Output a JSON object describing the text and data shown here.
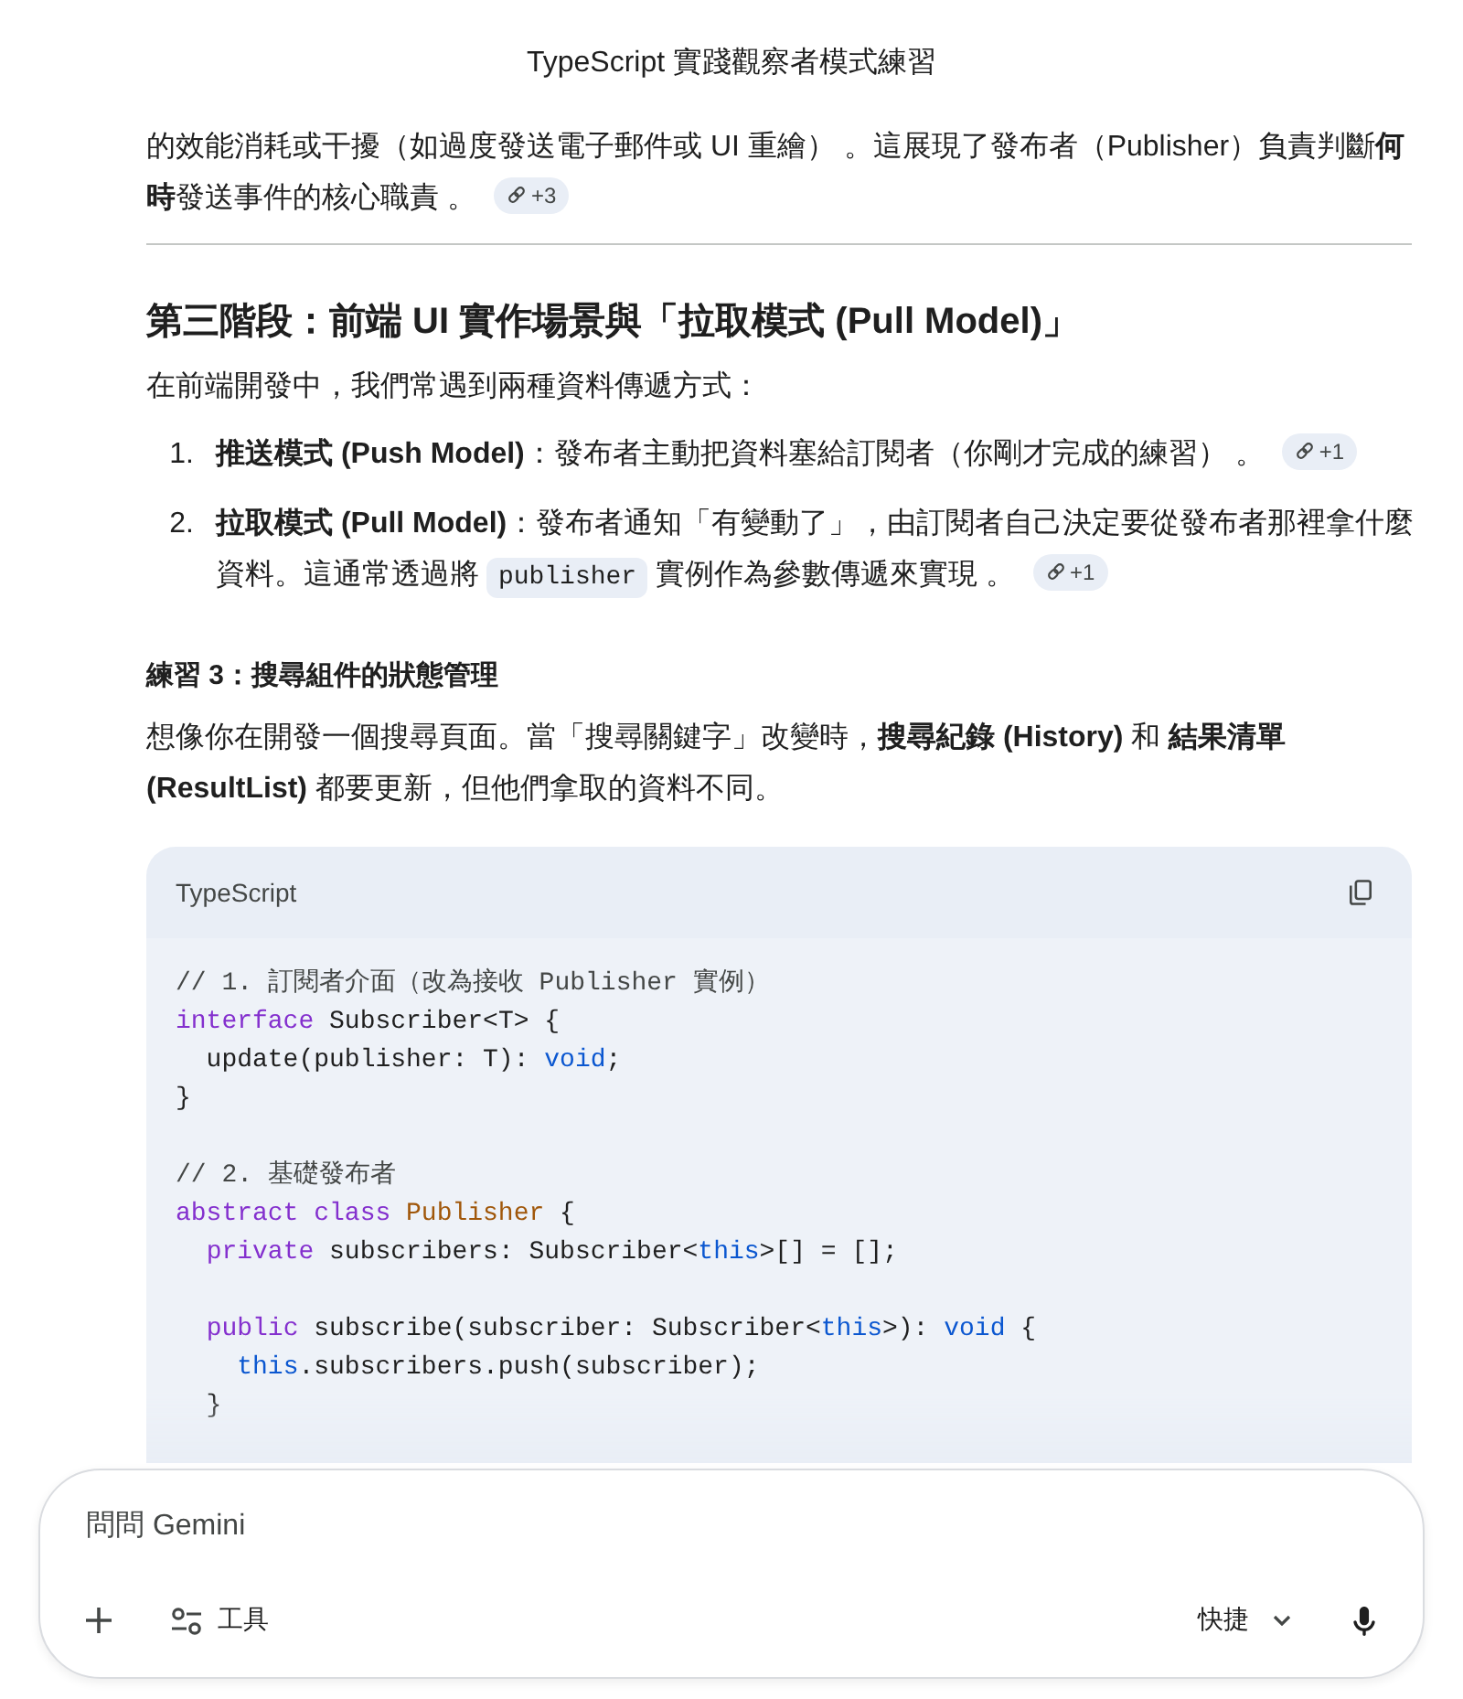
{
  "header": {
    "title": "TypeScript 實踐觀察者模式練習"
  },
  "article": {
    "blocks": [
      {
        "kind": "paragraph",
        "text": "的效能消耗或干擾（如過度發送電子郵件或 UI 重繪） 。這展現了發布者（Publisher）負責判斷**何時**發送事件的核心職責 。",
        "chip": "+3"
      },
      {
        "kind": "divider"
      },
      {
        "kind": "heading",
        "text": "第三階段：前端 UI 實作場景與「拉取模式 (Pull Model)」"
      },
      {
        "kind": "paragraph",
        "text": "在前端開發中，我們常遇到兩種資料傳遞方式："
      },
      {
        "kind": "ordered_list",
        "items": [
          {
            "number": "1.",
            "segments": [
              {
                "kind": "text",
                "text": "**推送模式 (Push Model)**：發布者主動把資料塞給訂閱者（你剛才完成的練習） 。"
              }
            ],
            "chip": "+1"
          },
          {
            "number": "2.",
            "segments": [
              {
                "kind": "text",
                "text": "**拉取模式 (Pull Model)**：發布者通知「有變動了」，由訂閱者自己決定要從發布者那裡拿什麼資料。這通常透過將 "
              },
              {
                "kind": "code",
                "text": "publisher"
              },
              {
                "kind": "text",
                "text": " 實例作為參數傳遞來實現 。"
              }
            ],
            "chip": "+1"
          }
        ]
      },
      {
        "kind": "subheading",
        "text": "練習 3：搜尋組件的狀態管理"
      },
      {
        "kind": "paragraph",
        "text": "想像你在開發一個搜尋頁面。當「搜尋關鍵字」改變時，**搜尋紀錄 (History)** 和 **結果清單 (ResultList)** 都要更新，但他們拿取的資料不同。"
      },
      {
        "kind": "code_block",
        "language": "TypeScript",
        "tokens": [
          {
            "kind": "comment",
            "text": "// 1. 訂閱者介面（改為接收 Publisher 實例）\n"
          },
          {
            "kind": "keyword",
            "text": "interface"
          },
          {
            "kind": "plain",
            "text": " Subscriber<T> {\n  update(publisher: T): "
          },
          {
            "kind": "builtin",
            "text": "void"
          },
          {
            "kind": "plain",
            "text": ";\n}\n\n"
          },
          {
            "kind": "comment",
            "text": "// 2. 基礎發布者\n"
          },
          {
            "kind": "keyword",
            "text": "abstract class"
          },
          {
            "kind": "type",
            "text": " Publisher"
          },
          {
            "kind": "plain",
            "text": " {\n  "
          },
          {
            "kind": "keyword",
            "text": "private"
          },
          {
            "kind": "plain",
            "text": " subscribers: Subscriber<"
          },
          {
            "kind": "builtin",
            "text": "this"
          },
          {
            "kind": "plain",
            "text": ">[] = [];\n\n  "
          },
          {
            "kind": "keyword",
            "text": "public"
          },
          {
            "kind": "plain",
            "text": " subscribe(subscriber: Subscriber<"
          },
          {
            "kind": "builtin",
            "text": "this"
          },
          {
            "kind": "plain",
            "text": ">): "
          },
          {
            "kind": "builtin",
            "text": "void"
          },
          {
            "kind": "plain",
            "text": " {\n    "
          },
          {
            "kind": "builtin",
            "text": "this"
          },
          {
            "kind": "plain",
            "text": ".subscribers.push(subscriber);\n  }"
          }
        ]
      }
    ]
  },
  "composer": {
    "placeholder": "問問 Gemini",
    "tools_label": "工具",
    "mode_label": "快捷"
  }
}
